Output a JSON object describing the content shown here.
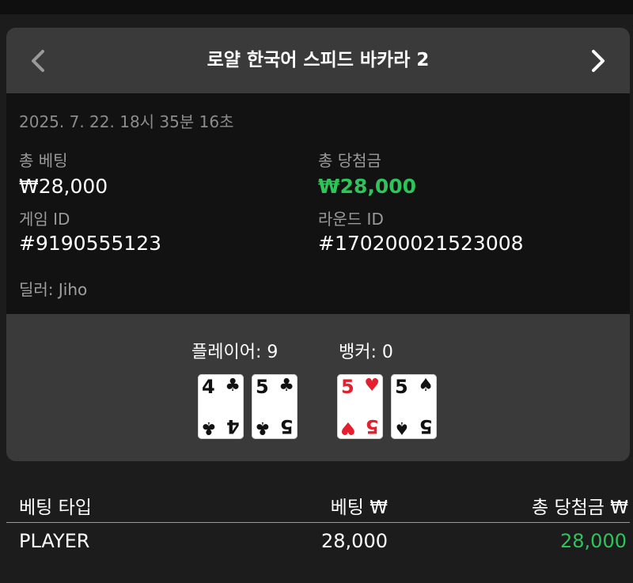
{
  "header": {
    "title": "로얄 한국어 스피드 바카라 2",
    "prev_icon": "chevron-left-icon",
    "next_icon": "chevron-right-icon"
  },
  "info": {
    "timestamp": "2025. 7. 22. 18시 35분 16초",
    "total_bet_label": "총 베팅",
    "total_bet_value": "₩28,000",
    "total_win_label": "총 당첨금",
    "total_win_value": "₩28,000",
    "game_id_label": "게임 ID",
    "game_id_value": "#9190555123",
    "round_id_label": "라운드 ID",
    "round_id_value": "#170200021523008",
    "dealer_label": "딜러:",
    "dealer_value": "Jiho"
  },
  "hands": {
    "player": {
      "label": "플레이어:",
      "score": "9",
      "cards": [
        {
          "rank": "4",
          "suit": "♣"
        },
        {
          "rank": "5",
          "suit": "♣"
        }
      ]
    },
    "banker": {
      "label": "뱅커:",
      "score": "0",
      "cards": [
        {
          "rank": "5",
          "suit": "♥"
        },
        {
          "rank": "5",
          "suit": "♠"
        }
      ]
    }
  },
  "bets_table": {
    "headers": [
      "베팅 타입",
      "베팅 ₩",
      "총 당첨금 ₩"
    ],
    "rows": [
      {
        "type": "PLAYER",
        "bet": "28,000",
        "win": "28,000"
      }
    ]
  },
  "colors": {
    "win_green": "#2ec45a",
    "panel": "#3a3a3a",
    "info_bg": "#121212"
  }
}
